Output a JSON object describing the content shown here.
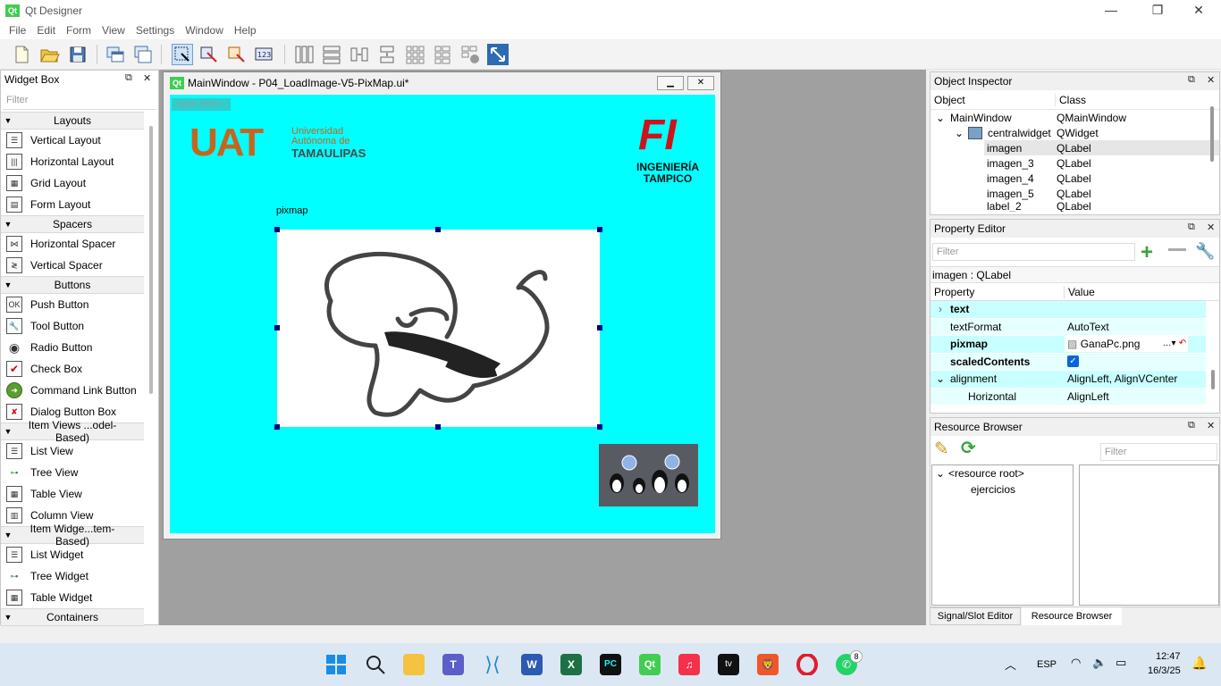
{
  "window": {
    "title": "Qt Designer",
    "qt_badge": "Qt",
    "minimize": "—",
    "restore": "❐",
    "close": "✕"
  },
  "menubar": [
    "File",
    "Edit",
    "Form",
    "View",
    "Settings",
    "Window",
    "Help"
  ],
  "widget_box": {
    "title": "Widget Box",
    "filter_placeholder": "Filter",
    "categories": [
      {
        "label": "Layouts",
        "items": [
          "Vertical Layout",
          "Horizontal Layout",
          "Grid Layout",
          "Form Layout"
        ]
      },
      {
        "label": "Spacers",
        "items": [
          "Horizontal Spacer",
          "Vertical Spacer"
        ]
      },
      {
        "label": "Buttons",
        "items": [
          "Push Button",
          "Tool Button",
          "Radio Button",
          "Check Box",
          "Command Link Button",
          "Dialog Button Box"
        ]
      },
      {
        "label": "Item Views ...odel-Based)",
        "items": [
          "List View",
          "Tree View",
          "Table View",
          "Column View"
        ]
      },
      {
        "label": "Item Widge...tem-Based)",
        "items": [
          "List Widget",
          "Tree Widget",
          "Table Widget"
        ]
      },
      {
        "label": "Containers",
        "items": []
      }
    ]
  },
  "subwindow": {
    "title": "MainWindow - P04_LoadImage-V5-PixMap.ui*",
    "menu_placeholder": "Type Here",
    "uat_logo": {
      "mark": "UAT",
      "line1": "Universidad",
      "line2": "Autónoma de",
      "line3": "TAMAULIPAS"
    },
    "fi_logo": {
      "mark": "FI",
      "line1": "INGENIERÍA",
      "line2": "TAMPICO"
    },
    "pixmap_label": "pixmap"
  },
  "object_inspector": {
    "title": "Object Inspector",
    "columns": [
      "Object",
      "Class"
    ],
    "rows": [
      {
        "object": "MainWindow",
        "class": "QMainWindow",
        "indent": 0,
        "expand": "⌄"
      },
      {
        "object": "centralwidget",
        "class": "QWidget",
        "indent": 1,
        "expand": "⌄"
      },
      {
        "object": "imagen",
        "class": "QLabel",
        "indent": 2,
        "expand": ""
      },
      {
        "object": "imagen_3",
        "class": "QLabel",
        "indent": 2,
        "expand": ""
      },
      {
        "object": "imagen_4",
        "class": "QLabel",
        "indent": 2,
        "expand": ""
      },
      {
        "object": "imagen_5",
        "class": "QLabel",
        "indent": 2,
        "expand": ""
      },
      {
        "object": "label_2",
        "class": "QLabel",
        "indent": 2,
        "expand": ""
      }
    ]
  },
  "property_editor": {
    "title": "Property Editor",
    "filter_placeholder": "Filter",
    "subject": "imagen : QLabel",
    "columns": [
      "Property",
      "Value"
    ],
    "rows": [
      {
        "name": "text",
        "value": "",
        "bold": true,
        "expand": "›",
        "indent": 0
      },
      {
        "name": "textFormat",
        "value": "AutoText",
        "bold": false,
        "expand": "",
        "indent": 0
      },
      {
        "name": "pixmap",
        "value": "GanaPc.png",
        "bold": true,
        "expand": "",
        "indent": 0
      },
      {
        "name": "scaledContents",
        "value": "",
        "bold": true,
        "expand": "",
        "indent": 0
      },
      {
        "name": "alignment",
        "value": "AlignLeft, AlignVCenter",
        "bold": false,
        "expand": "⌄",
        "indent": 0
      },
      {
        "name": "Horizontal",
        "value": "AlignLeft",
        "bold": false,
        "expand": "",
        "indent": 1
      }
    ]
  },
  "resource_browser": {
    "title": "Resource Browser",
    "filter_placeholder": "Filter",
    "tree": [
      "<resource root>",
      "ejercicios"
    ]
  },
  "bottom_tabs": [
    "Signal/Slot Editor",
    "Resource Browser"
  ],
  "taskbar": {
    "lang": "ESP",
    "time": "12:47",
    "date": "16/3/25",
    "whatsapp_badge": "8",
    "tray_arrow": "︿"
  }
}
